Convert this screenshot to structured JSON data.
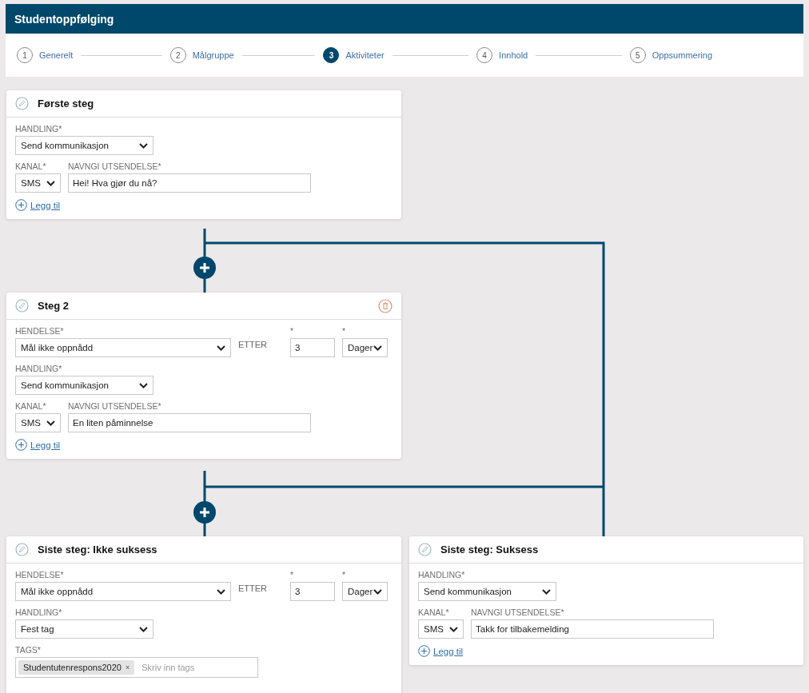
{
  "header": {
    "title": "Studentoppfølging"
  },
  "steps": [
    {
      "number": "1",
      "label": "Generelt",
      "selected": false
    },
    {
      "number": "2",
      "label": "Målgruppe",
      "selected": false
    },
    {
      "number": "3",
      "label": "Aktiviteter",
      "selected": true
    },
    {
      "number": "4",
      "label": "Innhold",
      "selected": false
    },
    {
      "number": "5",
      "label": "Oppsummering",
      "selected": false
    }
  ],
  "cards": [
    {
      "title": "Første steg",
      "deletable": false,
      "handling": {
        "label": "HANDLING*",
        "value": "Send kommunikasjon"
      },
      "kanal": {
        "label": "KANAL*",
        "value": "SMS"
      },
      "navn": {
        "label": "NAVNGI UTSENDELSE*",
        "value": "Hei! Hva gjør du nå?"
      },
      "add_link": "Legg til"
    },
    {
      "title": "Steg 2",
      "deletable": true,
      "hendelse": {
        "label": "HENDELSE*",
        "value": "Mål ikke oppnådd",
        "etter": "ETTER",
        "amount_label": "*",
        "amount": "3",
        "unit_label": "*",
        "unit": "Dager"
      },
      "handling": {
        "label": "HANDLING*",
        "value": "Send kommunikasjon"
      },
      "kanal": {
        "label": "KANAL*",
        "value": "SMS"
      },
      "navn": {
        "label": "NAVNGI UTSENDELSE*",
        "value": "En liten påminnelse"
      },
      "add_link": "Legg til"
    },
    {
      "title": "Siste steg: Ikke suksess",
      "deletable": false,
      "hendelse": {
        "label": "HENDELSE*",
        "value": "Mål ikke oppnådd",
        "etter": "ETTER",
        "amount_label": "*",
        "amount": "3",
        "unit_label": "*",
        "unit": "Dager"
      },
      "handling": {
        "label": "HANDLING*",
        "value": "Fest tag"
      },
      "tags": {
        "label": "TAGS*",
        "items": [
          {
            "text": "Studentutenrespons2020",
            "remove": "×"
          }
        ],
        "placeholder": "Skriv inn tags"
      }
    },
    {
      "title": "Siste steg: Suksess",
      "deletable": false,
      "handling": {
        "label": "HANDLING*",
        "value": "Send kommunikasjon"
      },
      "kanal": {
        "label": "KANAL*",
        "value": "SMS"
      },
      "navn": {
        "label": "NAVNGI UTSENDELSE*",
        "value": "Takk for tilbakemelding"
      },
      "add_link": "Legg til"
    }
  ]
}
